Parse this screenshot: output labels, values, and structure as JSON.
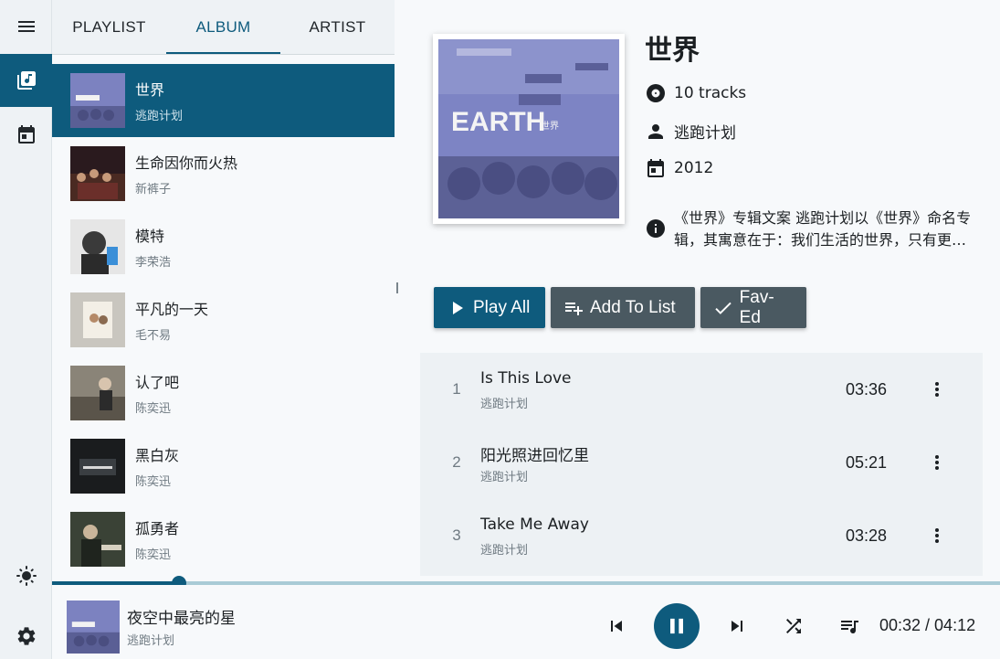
{
  "colors": {
    "accent": "#0e5b7d",
    "secondary_button": "#4a5961",
    "progress_track": "#a9cbd6"
  },
  "nav": {
    "icons": [
      "menu-icon",
      "library-music-icon",
      "calendar-icon",
      "brightness-icon",
      "settings-icon"
    ],
    "active": "library-music-icon"
  },
  "tabs": [
    {
      "label": "PLAYLIST"
    },
    {
      "label": "ALBUM"
    },
    {
      "label": "ARTIST"
    }
  ],
  "active_tab": "ALBUM",
  "albums": [
    {
      "title": "世界",
      "artist": "逃跑计划"
    },
    {
      "title": "生命因你而火热",
      "artist": "新裤子"
    },
    {
      "title": "模特",
      "artist": "李荣浩"
    },
    {
      "title": "平凡的一天",
      "artist": "毛不易"
    },
    {
      "title": "认了吧",
      "artist": "陈奕迅"
    },
    {
      "title": "黑白灰",
      "artist": "陈奕迅"
    },
    {
      "title": "孤勇者",
      "artist": "陈奕迅"
    }
  ],
  "selected_album_index": 0,
  "album": {
    "name": "世界",
    "tracks_text": "10 tracks",
    "artist": "逃跑计划",
    "year": "2012",
    "description": "《世界》专辑文案 逃跑计划以《世界》命名专辑，其寓意在于：我们生活的世界，只有更多的发现与感受，才会更加丰富与精彩。",
    "cover_text": "EARTH",
    "cover_subtext": "世界"
  },
  "actions": {
    "play_all": "Play All",
    "add_to_list": "Add To List",
    "fav": "Fav-Ed"
  },
  "tracks": [
    {
      "no": "1",
      "title": "Is This Love",
      "artist": "逃跑计划",
      "duration": "03:36"
    },
    {
      "no": "2",
      "title": "阳光照进回忆里",
      "artist": "逃跑计划",
      "duration": "05:21"
    },
    {
      "no": "3",
      "title": "Take Me Away",
      "artist": "逃跑计划",
      "duration": "03:28"
    }
  ],
  "player": {
    "title": "夜空中最亮的星",
    "artist": "逃跑计划",
    "elapsed": "00:32",
    "total": "04:12",
    "time_text": "00:32 / 04:12",
    "progress_fraction": 0.134,
    "state": "playing"
  }
}
